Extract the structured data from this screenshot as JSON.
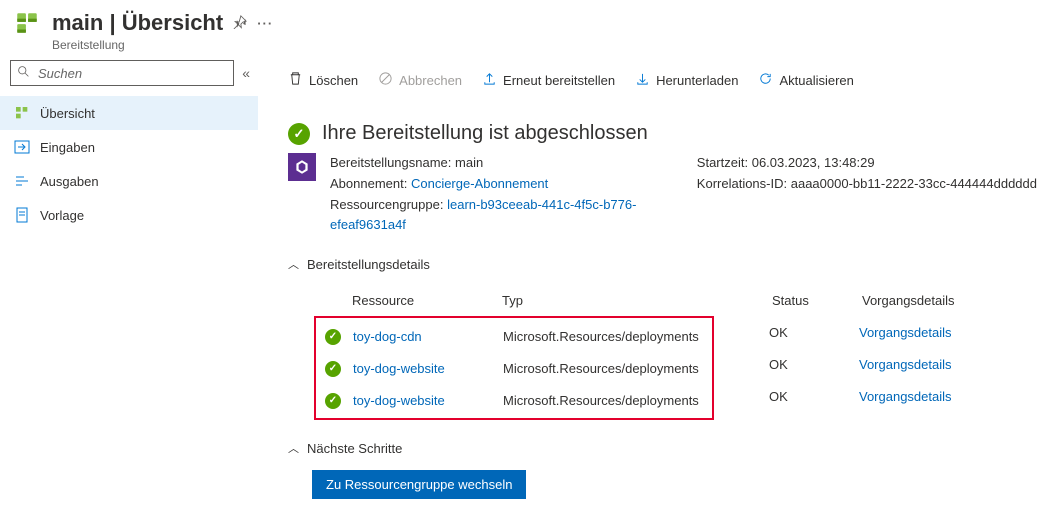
{
  "header": {
    "title": "main | Übersicht",
    "subtitle": "Bereitstellung"
  },
  "search": {
    "placeholder": "Suchen"
  },
  "nav": {
    "items": [
      {
        "label": "Übersicht"
      },
      {
        "label": "Eingaben"
      },
      {
        "label": "Ausgaben"
      },
      {
        "label": "Vorlage"
      }
    ]
  },
  "toolbar": {
    "delete": "Löschen",
    "cancel": "Abbrechen",
    "redeploy": "Erneut bereitstellen",
    "download": "Herunterladen",
    "refresh": "Aktualisieren"
  },
  "status": {
    "title": "Ihre Bereitstellung ist abgeschlossen"
  },
  "info": {
    "name_label": "Bereitstellungsname:",
    "name_value": "main",
    "sub_label": "Abonnement:",
    "sub_value": "Concierge-Abonnement",
    "rg_label": "Ressourcengruppe:",
    "rg_value": "learn-b93ceeab-441c-4f5c-b776-efeaf9631a4f",
    "start_label": "Startzeit:",
    "start_value": "06.03.2023, 13:48:29",
    "corr_label": "Korrelations-ID:",
    "corr_value": "aaaa0000-bb11-2222-33cc-444444dddddd"
  },
  "sections": {
    "details": "Bereitstellungsdetails",
    "next": "Nächste Schritte"
  },
  "table": {
    "headers": {
      "resource": "Ressource",
      "type": "Typ",
      "status": "Status",
      "op": "Vorgangsdetails"
    },
    "rows": [
      {
        "resource": "toy-dog-cdn",
        "type": "Microsoft.Resources/deployments",
        "status": "OK",
        "op": "Vorgangsdetails"
      },
      {
        "resource": "toy-dog-website",
        "type": "Microsoft.Resources/deployments",
        "status": "OK",
        "op": "Vorgangsdetails"
      },
      {
        "resource": "toy-dog-website",
        "type": "Microsoft.Resources/deployments",
        "status": "OK",
        "op": "Vorgangsdetails"
      }
    ]
  },
  "button": {
    "goto_rg": "Zu Ressourcengruppe wechseln"
  }
}
